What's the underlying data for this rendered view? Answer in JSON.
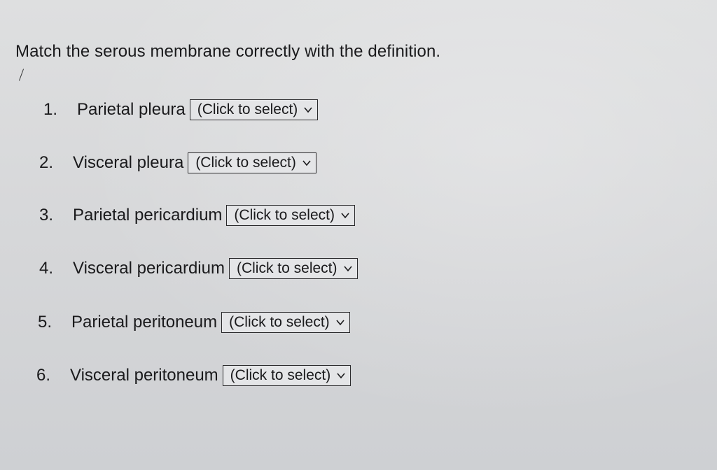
{
  "question": {
    "title": "Match the serous membrane correctly with the definition."
  },
  "items": [
    {
      "number": "1.",
      "term": "Parietal pleura",
      "select_value": "(Click to select)"
    },
    {
      "number": "2.",
      "term": "Visceral pleura",
      "select_value": "(Click to select)"
    },
    {
      "number": "3.",
      "term": "Parietal pericardium",
      "select_value": "(Click to select)"
    },
    {
      "number": "4.",
      "term": "Visceral pericardium",
      "select_value": "(Click to select)"
    },
    {
      "number": "5.",
      "term": "Parietal peritoneum",
      "select_value": "(Click to select)"
    },
    {
      "number": "6.",
      "term": "Visceral peritoneum",
      "select_value": "(Click to select)"
    }
  ],
  "icons": {
    "dropdown": "chevron-down-icon"
  }
}
